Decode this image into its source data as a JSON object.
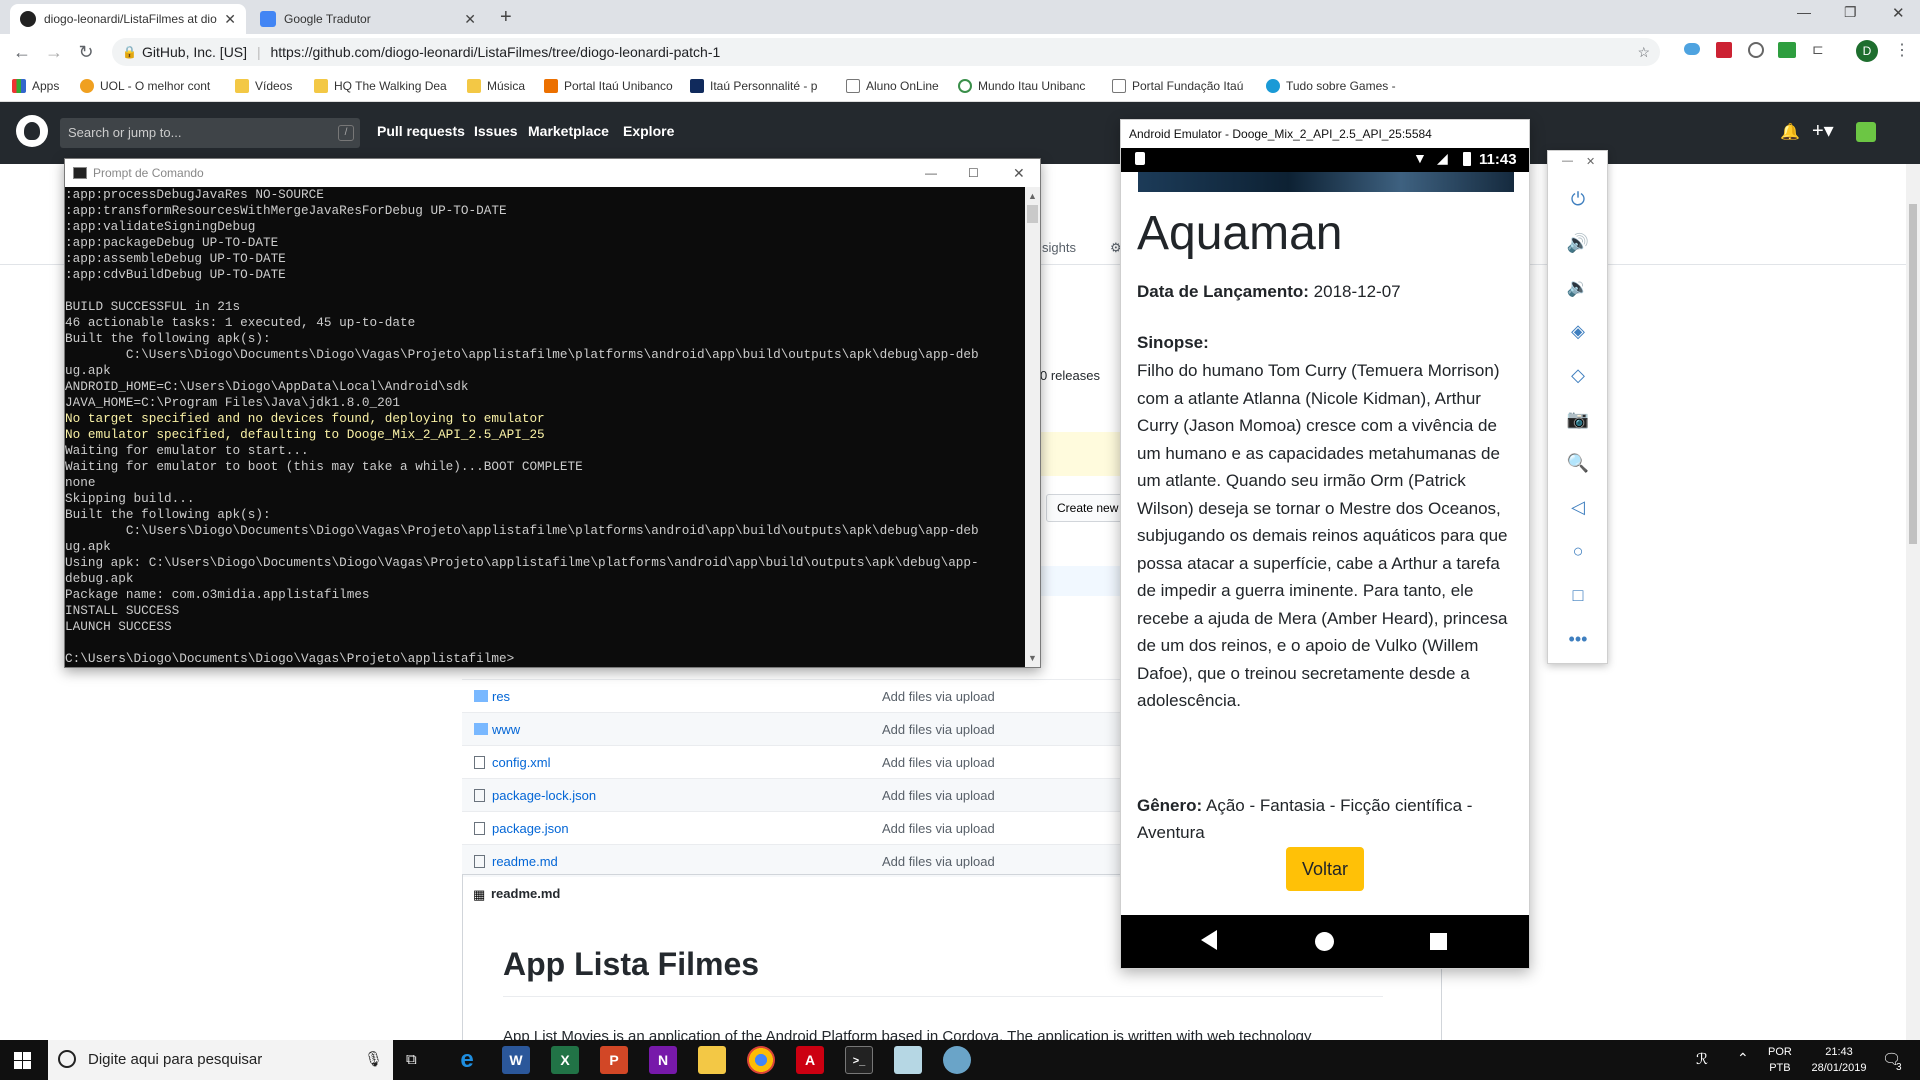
{
  "browser": {
    "tabs": [
      {
        "title": "diogo-leonardi/ListaFilmes at dio",
        "active": true
      },
      {
        "title": "Google Tradutor",
        "active": false
      }
    ],
    "omnibox": {
      "site": "GitHub, Inc. [US]",
      "url": "https://github.com/diogo-leonardi/ListaFilmes/tree/diogo-leonardi-patch-1"
    },
    "bookmarks": [
      "Apps",
      "UOL - O melhor cont",
      "Vídeos",
      "HQ The Walking Dea",
      "Música",
      "Portal Itaú Unibanco",
      "Itaú Personnalité - p",
      "Aluno OnLine",
      "Mundo Itau Unibanc",
      "Portal Fundação Itaú",
      "Tudo sobre Games -"
    ],
    "profile_initial": "D"
  },
  "github": {
    "search_placeholder": "Search or jump to...",
    "search_shortcut": "/",
    "nav": [
      "Pull requests",
      "Issues",
      "Marketplace",
      "Explore"
    ],
    "tab_insights": "sights",
    "releases": "0 releases",
    "create_new": "Create new",
    "files": [
      {
        "name": "res",
        "type": "folder",
        "message": "Add files via upload"
      },
      {
        "name": "www",
        "type": "folder",
        "message": "Add files via upload"
      },
      {
        "name": "config.xml",
        "type": "file",
        "message": "Add files via upload"
      },
      {
        "name": "package-lock.json",
        "type": "file",
        "message": "Add files via upload"
      },
      {
        "name": "package.json",
        "type": "file",
        "message": "Add files via upload"
      },
      {
        "name": "readme.md",
        "type": "file",
        "message": "Add files via upload"
      }
    ],
    "readme_header": "readme.md",
    "readme_title": "App Lista Filmes",
    "readme_text": "App List Movies is an application of the Android Platform based in Cordova. The application is written with web technology"
  },
  "cmd": {
    "title": "Prompt de Comando",
    "lines": [
      {
        "t": ":app:processDebugJavaRes NO-SOURCE",
        "y": false
      },
      {
        "t": ":app:transformResourcesWithMergeJavaResForDebug UP-TO-DATE",
        "y": false
      },
      {
        "t": ":app:validateSigningDebug",
        "y": false
      },
      {
        "t": ":app:packageDebug UP-TO-DATE",
        "y": false
      },
      {
        "t": ":app:assembleDebug UP-TO-DATE",
        "y": false
      },
      {
        "t": ":app:cdvBuildDebug UP-TO-DATE",
        "y": false
      },
      {
        "t": "",
        "y": false
      },
      {
        "t": "BUILD SUCCESSFUL in 21s",
        "y": false
      },
      {
        "t": "46 actionable tasks: 1 executed, 45 up-to-date",
        "y": false
      },
      {
        "t": "Built the following apk(s):",
        "y": false
      },
      {
        "t": "        C:\\Users\\Diogo\\Documents\\Diogo\\Vagas\\Projeto\\applistafilme\\platforms\\android\\app\\build\\outputs\\apk\\debug\\app-deb",
        "y": false
      },
      {
        "t": "ug.apk",
        "y": false
      },
      {
        "t": "ANDROID_HOME=C:\\Users\\Diogo\\AppData\\Local\\Android\\sdk",
        "y": false
      },
      {
        "t": "JAVA_HOME=C:\\Program Files\\Java\\jdk1.8.0_201",
        "y": false
      },
      {
        "t": "No target specified and no devices found, deploying to emulator",
        "y": true
      },
      {
        "t": "No emulator specified, defaulting to Dooge_Mix_2_API_2.5_API_25",
        "y": true
      },
      {
        "t": "Waiting for emulator to start...",
        "y": false
      },
      {
        "t": "Waiting for emulator to boot (this may take a while)...BOOT COMPLETE",
        "y": false
      },
      {
        "t": "none",
        "y": false
      },
      {
        "t": "Skipping build...",
        "y": false
      },
      {
        "t": "Built the following apk(s):",
        "y": false
      },
      {
        "t": "        C:\\Users\\Diogo\\Documents\\Diogo\\Vagas\\Projeto\\applistafilme\\platforms\\android\\app\\build\\outputs\\apk\\debug\\app-deb",
        "y": false
      },
      {
        "t": "ug.apk",
        "y": false
      },
      {
        "t": "Using apk: C:\\Users\\Diogo\\Documents\\Diogo\\Vagas\\Projeto\\applistafilme\\platforms\\android\\app\\build\\outputs\\apk\\debug\\app-",
        "y": false
      },
      {
        "t": "debug.apk",
        "y": false
      },
      {
        "t": "Package name: com.o3midia.applistafilmes",
        "y": false
      },
      {
        "t": "INSTALL SUCCESS",
        "y": false
      },
      {
        "t": "LAUNCH SUCCESS",
        "y": false
      },
      {
        "t": "",
        "y": false
      },
      {
        "t": "C:\\Users\\Diogo\\Documents\\Diogo\\Vagas\\Projeto\\applistafilme>",
        "y": false
      }
    ]
  },
  "emulator": {
    "title": "Android Emulator - Dooge_Mix_2_API_2.5_API_25:5584",
    "time": "11:43",
    "movie": {
      "title": "Aquaman",
      "release_label": "Data de Lançamento:",
      "release_value": "2018-12-07",
      "synopsis_label": "Sinopse:",
      "synopsis": "Filho do humano Tom Curry (Temuera Morrison) com a atlante Atlanna (Nicole Kidman), Arthur Curry (Jason Momoa) cresce com a vivência de um humano e as capacidades metahumanas de um atlante. Quando seu irmão Orm (Patrick Wilson) deseja se tornar o Mestre dos Oceanos, subjugando os demais reinos aquáticos para que possa atacar a superfície, cabe a Arthur a tarefa de impedir a guerra iminente. Para tanto, ele recebe a ajuda de Mera (Amber Heard), princesa de um dos reinos, e o apoio de Vulko (Willem Dafoe), que o treinou secretamente desde a adolescência.",
      "genre_label": "Gênero:",
      "genre_value": "Ação - Fantasia - Ficção científica - Aventura",
      "back_button": "Voltar"
    },
    "side_controls": [
      "power-icon",
      "volume-up-icon",
      "volume-down-icon",
      "rotate-left-icon",
      "rotate-right-icon",
      "camera-icon",
      "zoom-icon",
      "back-icon",
      "home-icon",
      "overview-icon",
      "more-icon"
    ]
  },
  "taskbar": {
    "search_placeholder": "Digite aqui para pesquisar",
    "lang_top": "POR",
    "lang_bottom": "PTB",
    "time": "21:43",
    "date": "28/01/2019",
    "notification_count": "3"
  },
  "colors": {
    "github_header": "#24292e",
    "link": "#0366d6",
    "voltar_button": "#ffc107",
    "cmd_warning": "#f9f1a5"
  }
}
